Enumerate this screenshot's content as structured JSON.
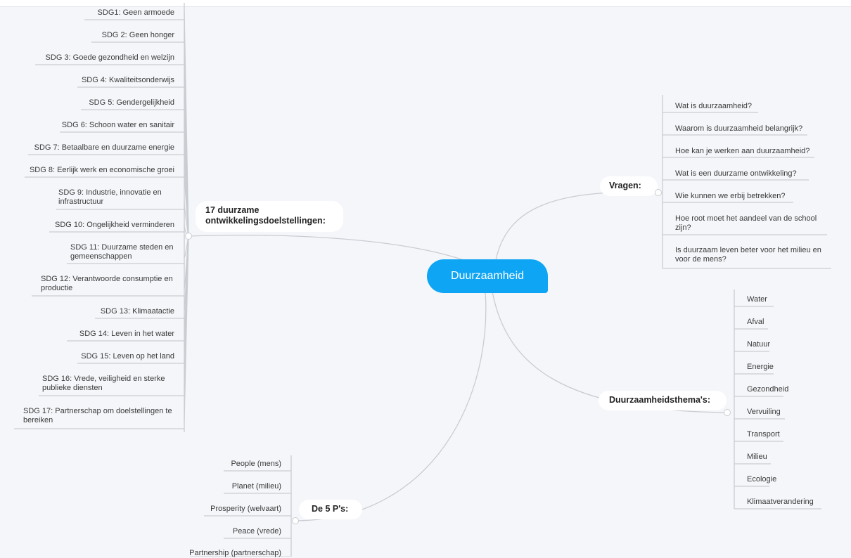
{
  "center": {
    "label": "Duurzaamheid"
  },
  "sdg": {
    "title": "17 duurzame ontwikkelingsdoelstellingen:",
    "items": [
      "SDG1: Geen armoede",
      "SDG 2: Geen honger",
      "SDG 3: Goede gezondheid en welzijn",
      "SDG 4: Kwaliteitsonderwijs",
      "SDG 5: Gendergelijkheid",
      "SDG 6: Schoon water en sanitair",
      "SDG 7: Betaalbare en duurzame energie",
      "SDG 8: Eerlijk werk en economische groei",
      "SDG 9: Industrie, innovatie en infrastructuur",
      "SDG 10: Ongelijkheid verminderen",
      "SDG 11: Duurzame steden en gemeenschappen",
      "SDG 12: Verantwoorde consumptie en productie",
      "SDG 13: Klimaatactie",
      "SDG 14: Leven in het water",
      "SDG 15: Leven op het land",
      "SDG 16: Vrede, veiligheid en sterke publieke diensten",
      "SDG 17: Partnerschap om doelstellingen te bereiken"
    ]
  },
  "vragen": {
    "title": "Vragen:",
    "items": [
      "Wat is duurzaamheid?",
      "Waarom is duurzaamheid belangrijk?",
      "Hoe kan je werken aan duurzaamheid?",
      "Wat is een duurzame ontwikkeling?",
      "Wie kunnen we erbij betrekken?",
      "Hoe root moet het aandeel van de school zijn?",
      "Is duurzaam leven beter voor het milieu en voor de mens?"
    ]
  },
  "themas": {
    "title": "Duurzaamheidsthema's:",
    "items": [
      "Water",
      "Afval",
      "Natuur",
      "Energie",
      "Gezondheid",
      "Vervuiling",
      "Transport",
      "Milieu",
      "Ecologie",
      "Klimaatverandering"
    ]
  },
  "ps": {
    "title": "De 5 P's:",
    "items": [
      "People (mens)",
      "Planet (milieu)",
      "Prosperity (welvaart)",
      "Peace (vrede)",
      "Partnership (partnerschap)"
    ]
  },
  "colors": {
    "accent": "#0ea5f4",
    "line": "#c9ccd2",
    "background": "#f4f6f9"
  }
}
